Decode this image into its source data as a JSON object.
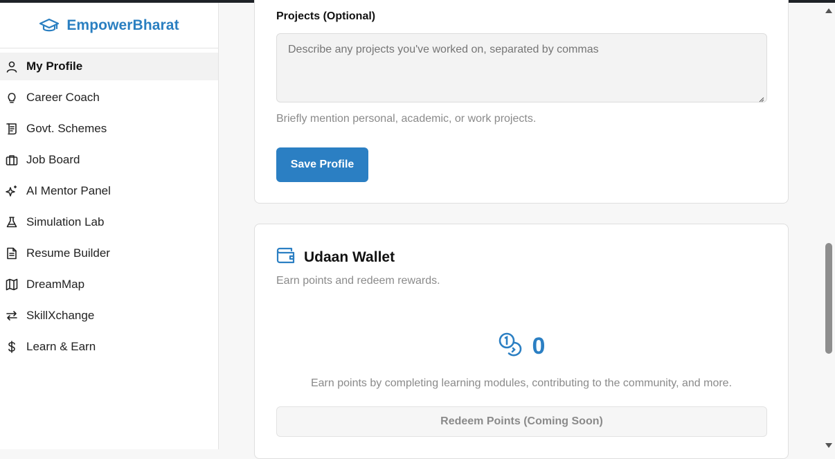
{
  "brand": {
    "name": "EmpowerBharat",
    "icon": "graduation-cap-icon",
    "color": "#2a7fc1"
  },
  "sidebar": {
    "items": [
      {
        "label": "My Profile",
        "icon": "user-icon",
        "active": true
      },
      {
        "label": "Career Coach",
        "icon": "lightbulb-icon"
      },
      {
        "label": "Govt. Schemes",
        "icon": "scroll-icon"
      },
      {
        "label": "Job Board",
        "icon": "briefcase-icon"
      },
      {
        "label": "AI Mentor Panel",
        "icon": "sparkles-icon"
      },
      {
        "label": "Simulation Lab",
        "icon": "flask-icon"
      },
      {
        "label": "Resume Builder",
        "icon": "document-icon"
      },
      {
        "label": "DreamMap",
        "icon": "map-icon"
      },
      {
        "label": "SkillXchange",
        "icon": "exchange-arrows-icon"
      },
      {
        "label": "Learn & Earn",
        "icon": "dollar-icon"
      }
    ]
  },
  "profile_form": {
    "projects_label": "Projects (Optional)",
    "projects_placeholder": "Describe any projects you've worked on, separated by commas",
    "projects_helper": "Briefly mention personal, academic, or work projects.",
    "save_label": "Save Profile"
  },
  "wallet": {
    "title": "Udaan Wallet",
    "subtitle": "Earn points and redeem rewards.",
    "points": "0",
    "points_icon": "coins-icon",
    "description": "Earn points by completing learning modules, contributing to the community, and more.",
    "redeem_label": "Redeem Points (Coming Soon)"
  },
  "colors": {
    "accent": "#2b7fc3",
    "muted_text": "#8a8a8a"
  }
}
